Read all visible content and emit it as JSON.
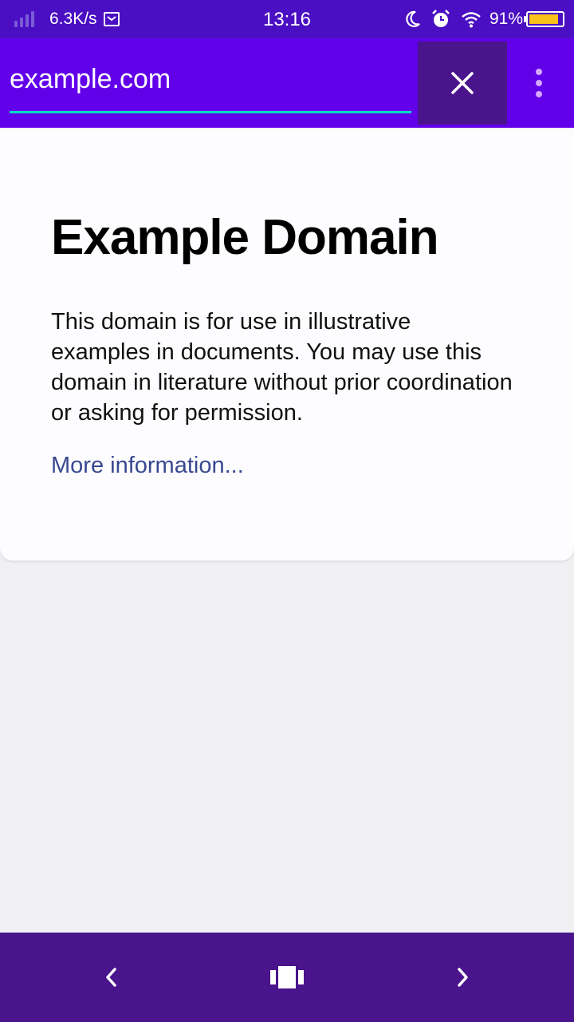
{
  "status_bar": {
    "net_speed": "6.3K/s",
    "time": "13:16",
    "battery_percent": "91%",
    "battery_level": 0.91,
    "icons": [
      "signal-icon",
      "message-icon",
      "moon-icon",
      "alarm-icon",
      "wifi-icon",
      "battery-icon"
    ]
  },
  "toolbar": {
    "url": "example.com",
    "close_icon": "close-icon",
    "menu_icon": "more-vert-icon"
  },
  "page": {
    "title": "Example Domain",
    "description": "This domain is for use in illustrative examples in documents. You may use this domain in literature without prior coordination or asking for permission.",
    "link_text": "More information..."
  },
  "bottom_nav": {
    "icons": [
      "chevron-left-icon",
      "tabs-icon",
      "chevron-right-icon"
    ]
  },
  "colors": {
    "status_bar": "#4a0fc2",
    "toolbar": "#6200ea",
    "close_button_bg": "#4a148c",
    "url_underline": "#03dac6",
    "bottom_bar": "#4a148c",
    "link": "#38488f",
    "battery_fill": "#f6c21b"
  }
}
